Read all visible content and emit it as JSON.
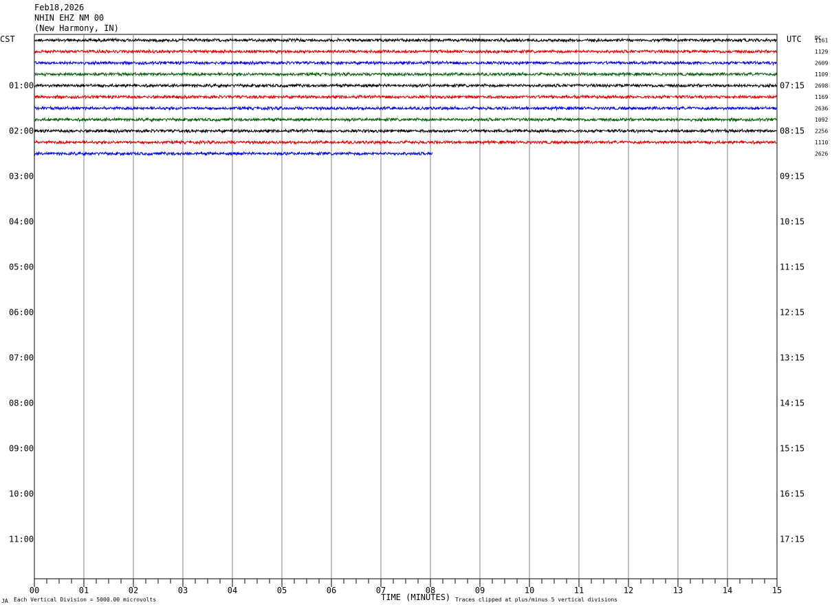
{
  "header": {
    "date": "Feb18,2026",
    "station": "NHIN EHZ NM 00",
    "location": "(New Harmony, IN)"
  },
  "left_zone_label": "CST",
  "right_zone_label": "UTC",
  "dc_label": "DC",
  "footer": {
    "corner_mark": "JA",
    "scale_note": "Each Vertical Division = 5000.00 microvolts",
    "clip_note": "Traces clipped at plus/minus 5 vertical divisions"
  },
  "chart_data": {
    "type": "line",
    "title": "",
    "xlabel": "TIME (MINUTES)",
    "xlim": [
      0,
      15
    ],
    "x_ticks": [
      "00",
      "01",
      "02",
      "03",
      "04",
      "05",
      "06",
      "07",
      "08",
      "09",
      "10",
      "11",
      "12",
      "13",
      "14",
      "15"
    ],
    "row_count": 48,
    "left_hour_labels": [
      "01:00",
      "02:00",
      "03:00",
      "04:00",
      "05:00",
      "06:00",
      "07:00",
      "08:00",
      "09:00",
      "10:00",
      "11:00"
    ],
    "right_hour_labels": [
      "07:15",
      "08:15",
      "09:15",
      "10:15",
      "11:15",
      "12:15",
      "13:15",
      "14:15",
      "15:15",
      "16:15",
      "17:15"
    ],
    "hour_label_rows": [
      4,
      8,
      12,
      16,
      20,
      24,
      28,
      32,
      36,
      40,
      44
    ],
    "trace_colors": [
      "#000000",
      "#e00000",
      "#0000e0",
      "#006000"
    ],
    "traces": [
      {
        "row": 0,
        "end_minute": 15,
        "dc": "1161"
      },
      {
        "row": 1,
        "end_minute": 15,
        "dc": "1129"
      },
      {
        "row": 2,
        "end_minute": 15,
        "dc": "2609"
      },
      {
        "row": 3,
        "end_minute": 15,
        "dc": "1109"
      },
      {
        "row": 4,
        "end_minute": 15,
        "dc": "2698"
      },
      {
        "row": 5,
        "end_minute": 15,
        "dc": "1169"
      },
      {
        "row": 6,
        "end_minute": 15,
        "dc": "2636"
      },
      {
        "row": 7,
        "end_minute": 15,
        "dc": "1092"
      },
      {
        "row": 8,
        "end_minute": 15,
        "dc": "2256"
      },
      {
        "row": 9,
        "end_minute": 15,
        "dc": "1110"
      },
      {
        "row": 10,
        "end_minute": 8.05,
        "dc": "2626"
      }
    ]
  }
}
